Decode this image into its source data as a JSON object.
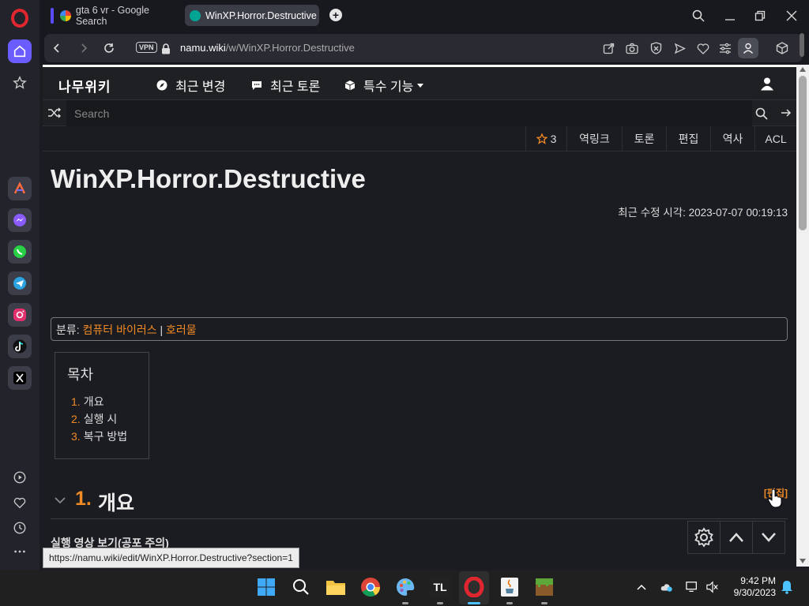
{
  "browser": {
    "tabs": [
      {
        "label": "gta 6 vr - Google Search",
        "active": false
      },
      {
        "label": "WinXP.Horror.Destructive",
        "active": true
      }
    ],
    "new_tab_symbol": "+",
    "vpn_badge": "VPN",
    "url": {
      "host": "namu.wiki",
      "path": "/w/WinXP.Horror.Destructive"
    },
    "status_url": "https://namu.wiki/edit/WinXP.Horror.Destructive?section=1"
  },
  "sidebar": {
    "apps": [
      "aria-icon",
      "messenger-icon",
      "whatsapp-icon",
      "telegram-icon",
      "instagram-icon",
      "tiktok-icon",
      "x-icon"
    ],
    "bottom": [
      "player-icon",
      "heart-icon",
      "history-icon",
      "more-icon"
    ]
  },
  "namu": {
    "logo": "나무위키",
    "nav": {
      "recent_changes": "최근 변경",
      "recent_discuss": "최근 토론",
      "special": "특수 기능"
    },
    "search_placeholder": "Search",
    "actions": {
      "star_count": "3",
      "backlinks": "역링크",
      "discuss": "토론",
      "edit": "편집",
      "history": "역사",
      "acl": "ACL"
    },
    "title": "WinXP.Horror.Destructive",
    "modified": "최근 수정 시각: 2023-07-07 00:19:13",
    "category": {
      "label": "분류:",
      "items": [
        "컴퓨터 바이러스",
        "호러물"
      ],
      "sep": "|"
    },
    "toc": {
      "title": "목차",
      "items": [
        {
          "num": "1.",
          "text": "개요"
        },
        {
          "num": "2.",
          "text": "실행 시"
        },
        {
          "num": "3.",
          "text": "복구 방법"
        }
      ]
    },
    "section": {
      "num": "1.",
      "title": "개요",
      "edit": "[편집]"
    },
    "subtext": "실행 영상 보기(공포 주의)"
  },
  "taskbar": {
    "clock_time": "9:42 PM",
    "clock_date": "9/30/2023",
    "apps": [
      "windows-start",
      "search",
      "file-explorer",
      "chrome",
      "paint",
      "tl-launcher",
      "opera",
      "java",
      "minecraft"
    ]
  },
  "colors": {
    "accent": "#f08a24",
    "opera_red": "#e0262e",
    "home_purple": "#6a5cff"
  }
}
